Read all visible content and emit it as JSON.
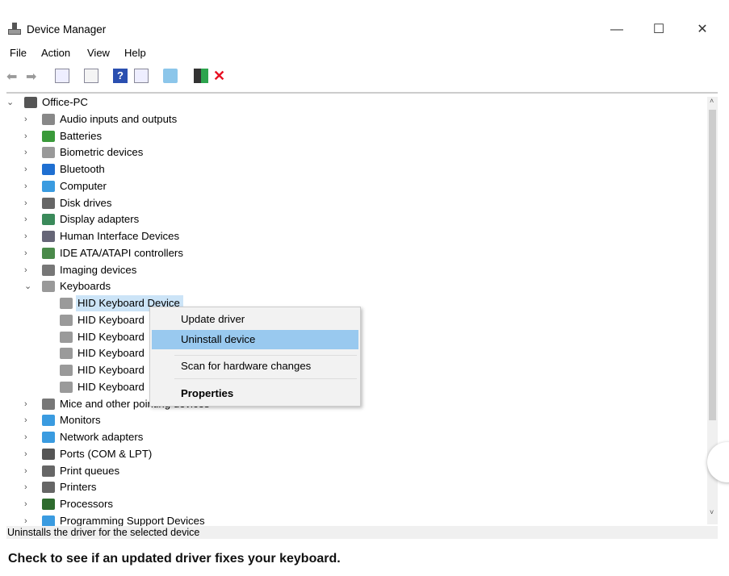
{
  "window": {
    "title": "Device Manager",
    "minimize": "—",
    "maximize": "☐",
    "close": "✕"
  },
  "menubar": [
    "File",
    "Action",
    "View",
    "Help"
  ],
  "toolbar": [
    "back-icon",
    "forward-icon",
    "show-hide-console-tree-icon",
    "properties-icon",
    "help-icon",
    "action-pane-icon",
    "scan-hardware-icon",
    "update-driver-icon",
    "uninstall-icon"
  ],
  "tree": {
    "root": "Office-PC",
    "items": [
      {
        "label": "Audio inputs and outputs",
        "icon": "speaker",
        "color": "#888"
      },
      {
        "label": "Batteries",
        "icon": "battery",
        "color": "#3a9a3a"
      },
      {
        "label": "Biometric devices",
        "icon": "fingerprint",
        "color": "#999"
      },
      {
        "label": "Bluetooth",
        "icon": "bluetooth",
        "color": "#1f6fd1"
      },
      {
        "label": "Computer",
        "icon": "monitor",
        "color": "#3a9be0"
      },
      {
        "label": "Disk drives",
        "icon": "disk",
        "color": "#666"
      },
      {
        "label": "Display adapters",
        "icon": "display",
        "color": "#3a8a5a"
      },
      {
        "label": "Human Interface Devices",
        "icon": "hid",
        "color": "#667"
      },
      {
        "label": "IDE ATA/ATAPI controllers",
        "icon": "ide",
        "color": "#4a8a4a"
      },
      {
        "label": "Imaging devices",
        "icon": "camera",
        "color": "#777"
      },
      {
        "label": "Keyboards",
        "icon": "keyboard",
        "color": "#999",
        "expanded": true,
        "children": [
          "HID Keyboard Device",
          "HID Keyboard",
          "HID Keyboard",
          "HID Keyboard",
          "HID Keyboard",
          "HID Keyboard"
        ]
      },
      {
        "label": "Mice and other pointing devices",
        "icon": "mouse",
        "color": "#777"
      },
      {
        "label": "Monitors",
        "icon": "monitor",
        "color": "#3a9be0"
      },
      {
        "label": "Network adapters",
        "icon": "network",
        "color": "#3a9be0"
      },
      {
        "label": "Ports (COM & LPT)",
        "icon": "port",
        "color": "#555"
      },
      {
        "label": "Print queues",
        "icon": "printer",
        "color": "#666"
      },
      {
        "label": "Printers",
        "icon": "printer",
        "color": "#666"
      },
      {
        "label": "Processors",
        "icon": "chip",
        "color": "#2e6b2e"
      },
      {
        "label": "Programming Support Devices",
        "icon": "monitor",
        "color": "#3a9be0"
      }
    ]
  },
  "context_menu": {
    "items": [
      "Update driver",
      "Uninstall device",
      "Scan for hardware changes",
      "Properties"
    ],
    "highlighted": "Uninstall device"
  },
  "status": "Uninstalls the driver for the selected device",
  "caption": "Check to see if an updated driver fixes your keyboard.",
  "colors": {
    "highlight": "#99c9ef",
    "selection": "#cce4f7",
    "uninstall_x": "#e81123"
  }
}
